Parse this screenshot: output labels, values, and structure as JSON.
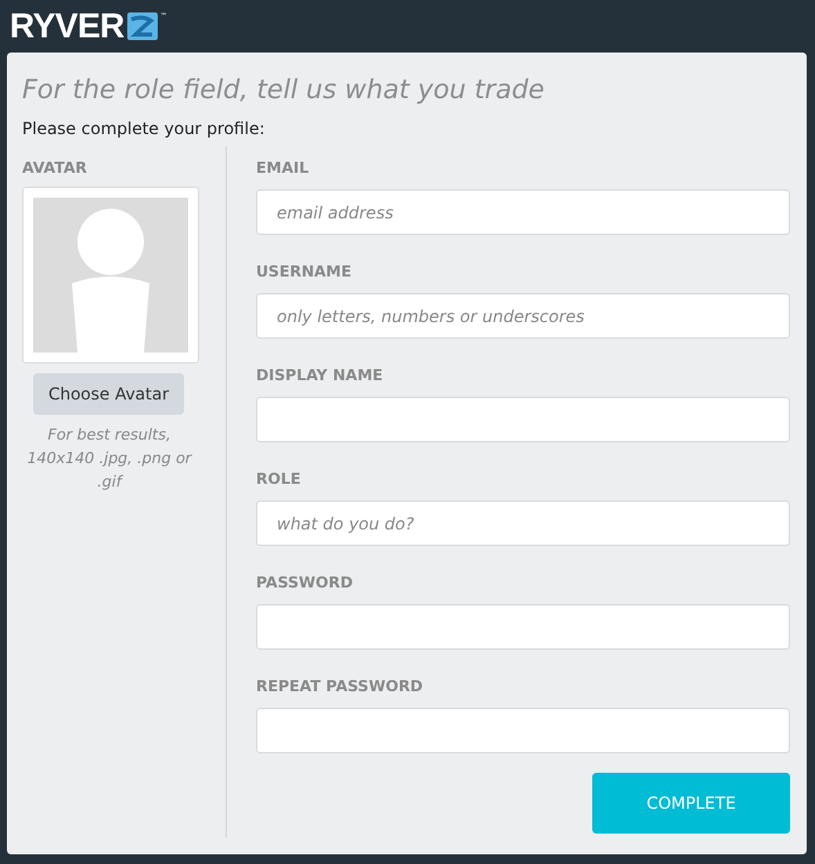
{
  "logo": {
    "text": "RYVER",
    "trademark": "™"
  },
  "heading": "For the role field, tell us what you trade",
  "intro": "Please complete your profile:",
  "avatar": {
    "label": "AVATAR",
    "button": "Choose Avatar",
    "hint": "For best results, 140x140 .jpg, .png or .gif"
  },
  "fields": [
    {
      "label": "EMAIL",
      "placeholder": "email address"
    },
    {
      "label": "USERNAME",
      "placeholder": "only letters, numbers or underscores"
    },
    {
      "label": "DISPLAY NAME"
    },
    {
      "label": "ROLE",
      "placeholder": "what do you do?"
    },
    {
      "label": "PASSWORD"
    },
    {
      "label": "REPEAT PASSWORD"
    }
  ],
  "submit": "COMPLETE"
}
